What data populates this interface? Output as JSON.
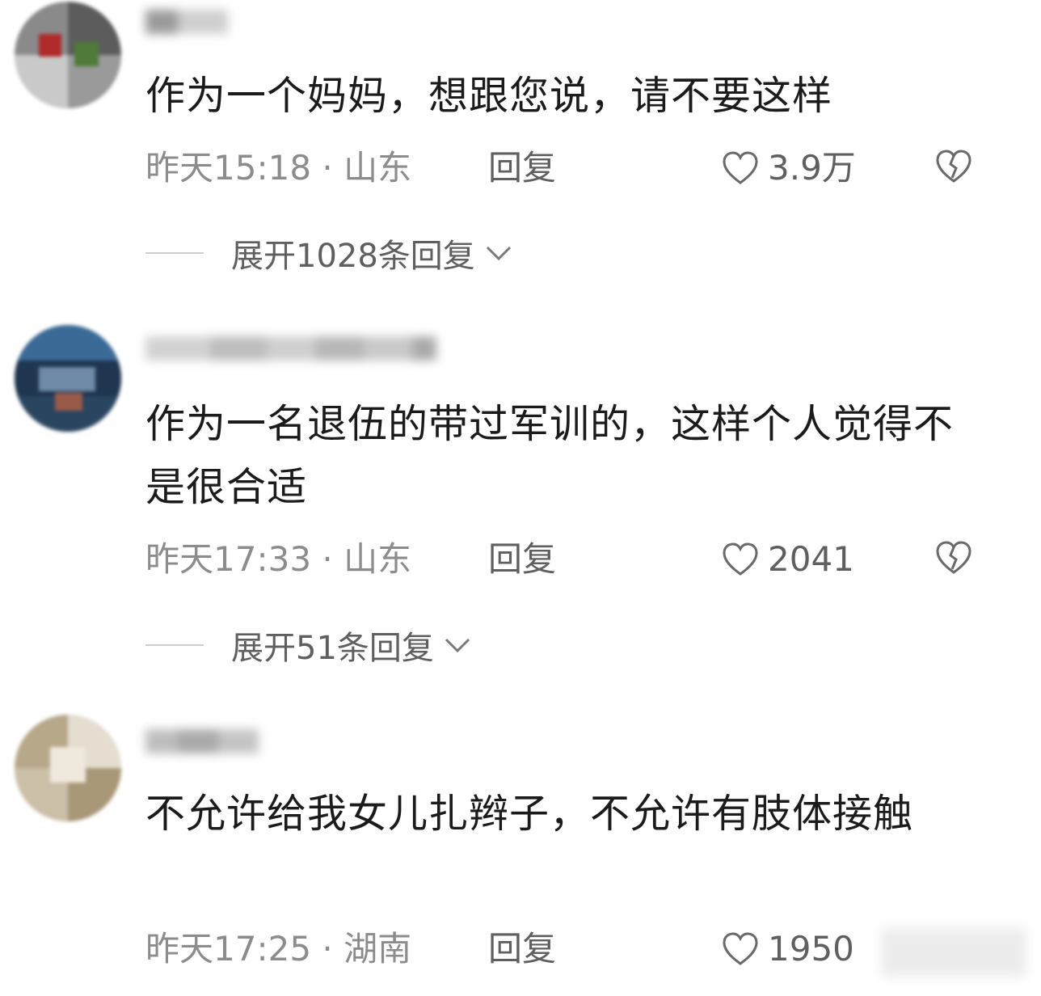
{
  "comments": [
    {
      "text": "作为一个妈妈，想跟您说，请不要这样",
      "time": "昨天15:18",
      "location": "山东",
      "reply_label": "回复",
      "likes": "3.9万",
      "expand_label": "展开1028条回复"
    },
    {
      "text": "作为一名退伍的带过军训的，这样个人觉得不是很合适",
      "time": "昨天17:33",
      "location": "山东",
      "reply_label": "回复",
      "likes": "2041",
      "expand_label": "展开51条回复"
    },
    {
      "text": "不允许给我女儿扎辫子，不允许有肢体接触",
      "time": "昨天17:25",
      "location": "湖南",
      "reply_label": "回复",
      "likes": "1950"
    }
  ],
  "meta_separator": " · ",
  "colors": {
    "text": "#1b1b1b",
    "meta": "#8c8c8c",
    "action": "#5f5f5f"
  }
}
